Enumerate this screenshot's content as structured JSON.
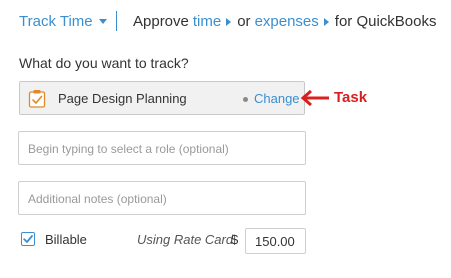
{
  "header": {
    "track_label": "Track Time",
    "approve_prefix": "Approve",
    "time_link": "time",
    "or_text": "or",
    "expenses_link": "expenses",
    "suffix": "for QuickBooks"
  },
  "form": {
    "question": "What do you want to track?",
    "task": {
      "icon": "clipboard-check-icon",
      "name": "Page Design Planning",
      "change_label": "Change"
    },
    "annotation": "Task",
    "role_placeholder": "Begin typing to select a role (optional)",
    "notes_placeholder": "Additional notes (optional)",
    "billable_label": "Billable",
    "billable_checked": true,
    "rate_label": "Using Rate Card",
    "currency": "$",
    "rate_value": "150.00"
  },
  "colors": {
    "link": "#3b8fd0",
    "annotation": "#d92020"
  }
}
